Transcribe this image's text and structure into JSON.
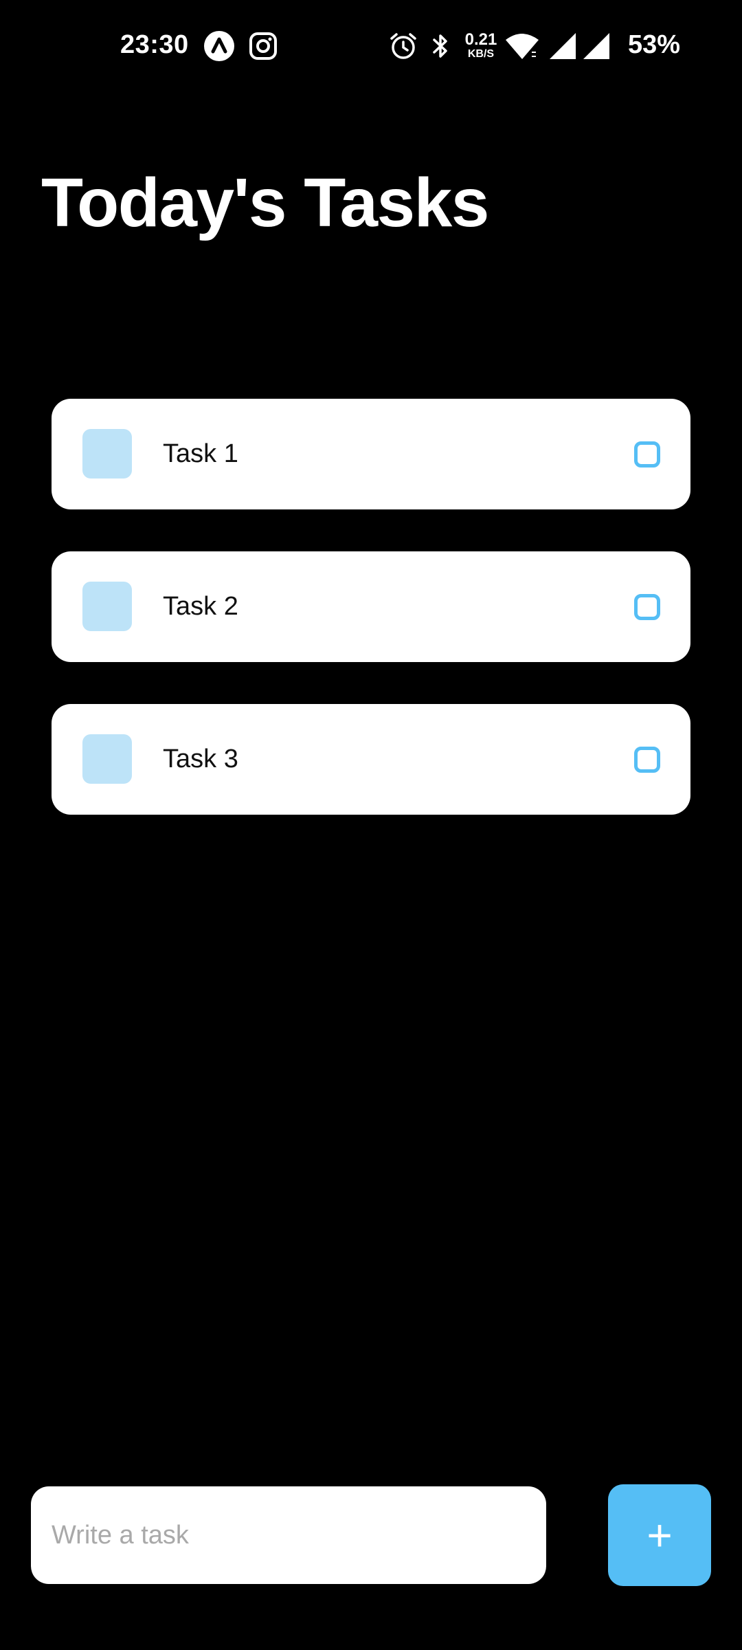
{
  "status_bar": {
    "time": "23:30",
    "net_speed_value": "0.21",
    "net_speed_unit": "KB/S",
    "battery": "53%",
    "icons": [
      "app-a-icon",
      "instagram-icon",
      "alarm-icon",
      "bluetooth-icon",
      "wifi-icon",
      "signal-icon",
      "signal-icon"
    ]
  },
  "header": {
    "title": "Today's Tasks"
  },
  "tasks": [
    {
      "label": "Task 1"
    },
    {
      "label": "Task 2"
    },
    {
      "label": "Task 3"
    }
  ],
  "composer": {
    "placeholder": "Write a task",
    "add_label": "+"
  },
  "colors": {
    "background": "#000000",
    "card": "#ffffff",
    "accent": "#55bef5",
    "task_square": "#bde3f8"
  }
}
